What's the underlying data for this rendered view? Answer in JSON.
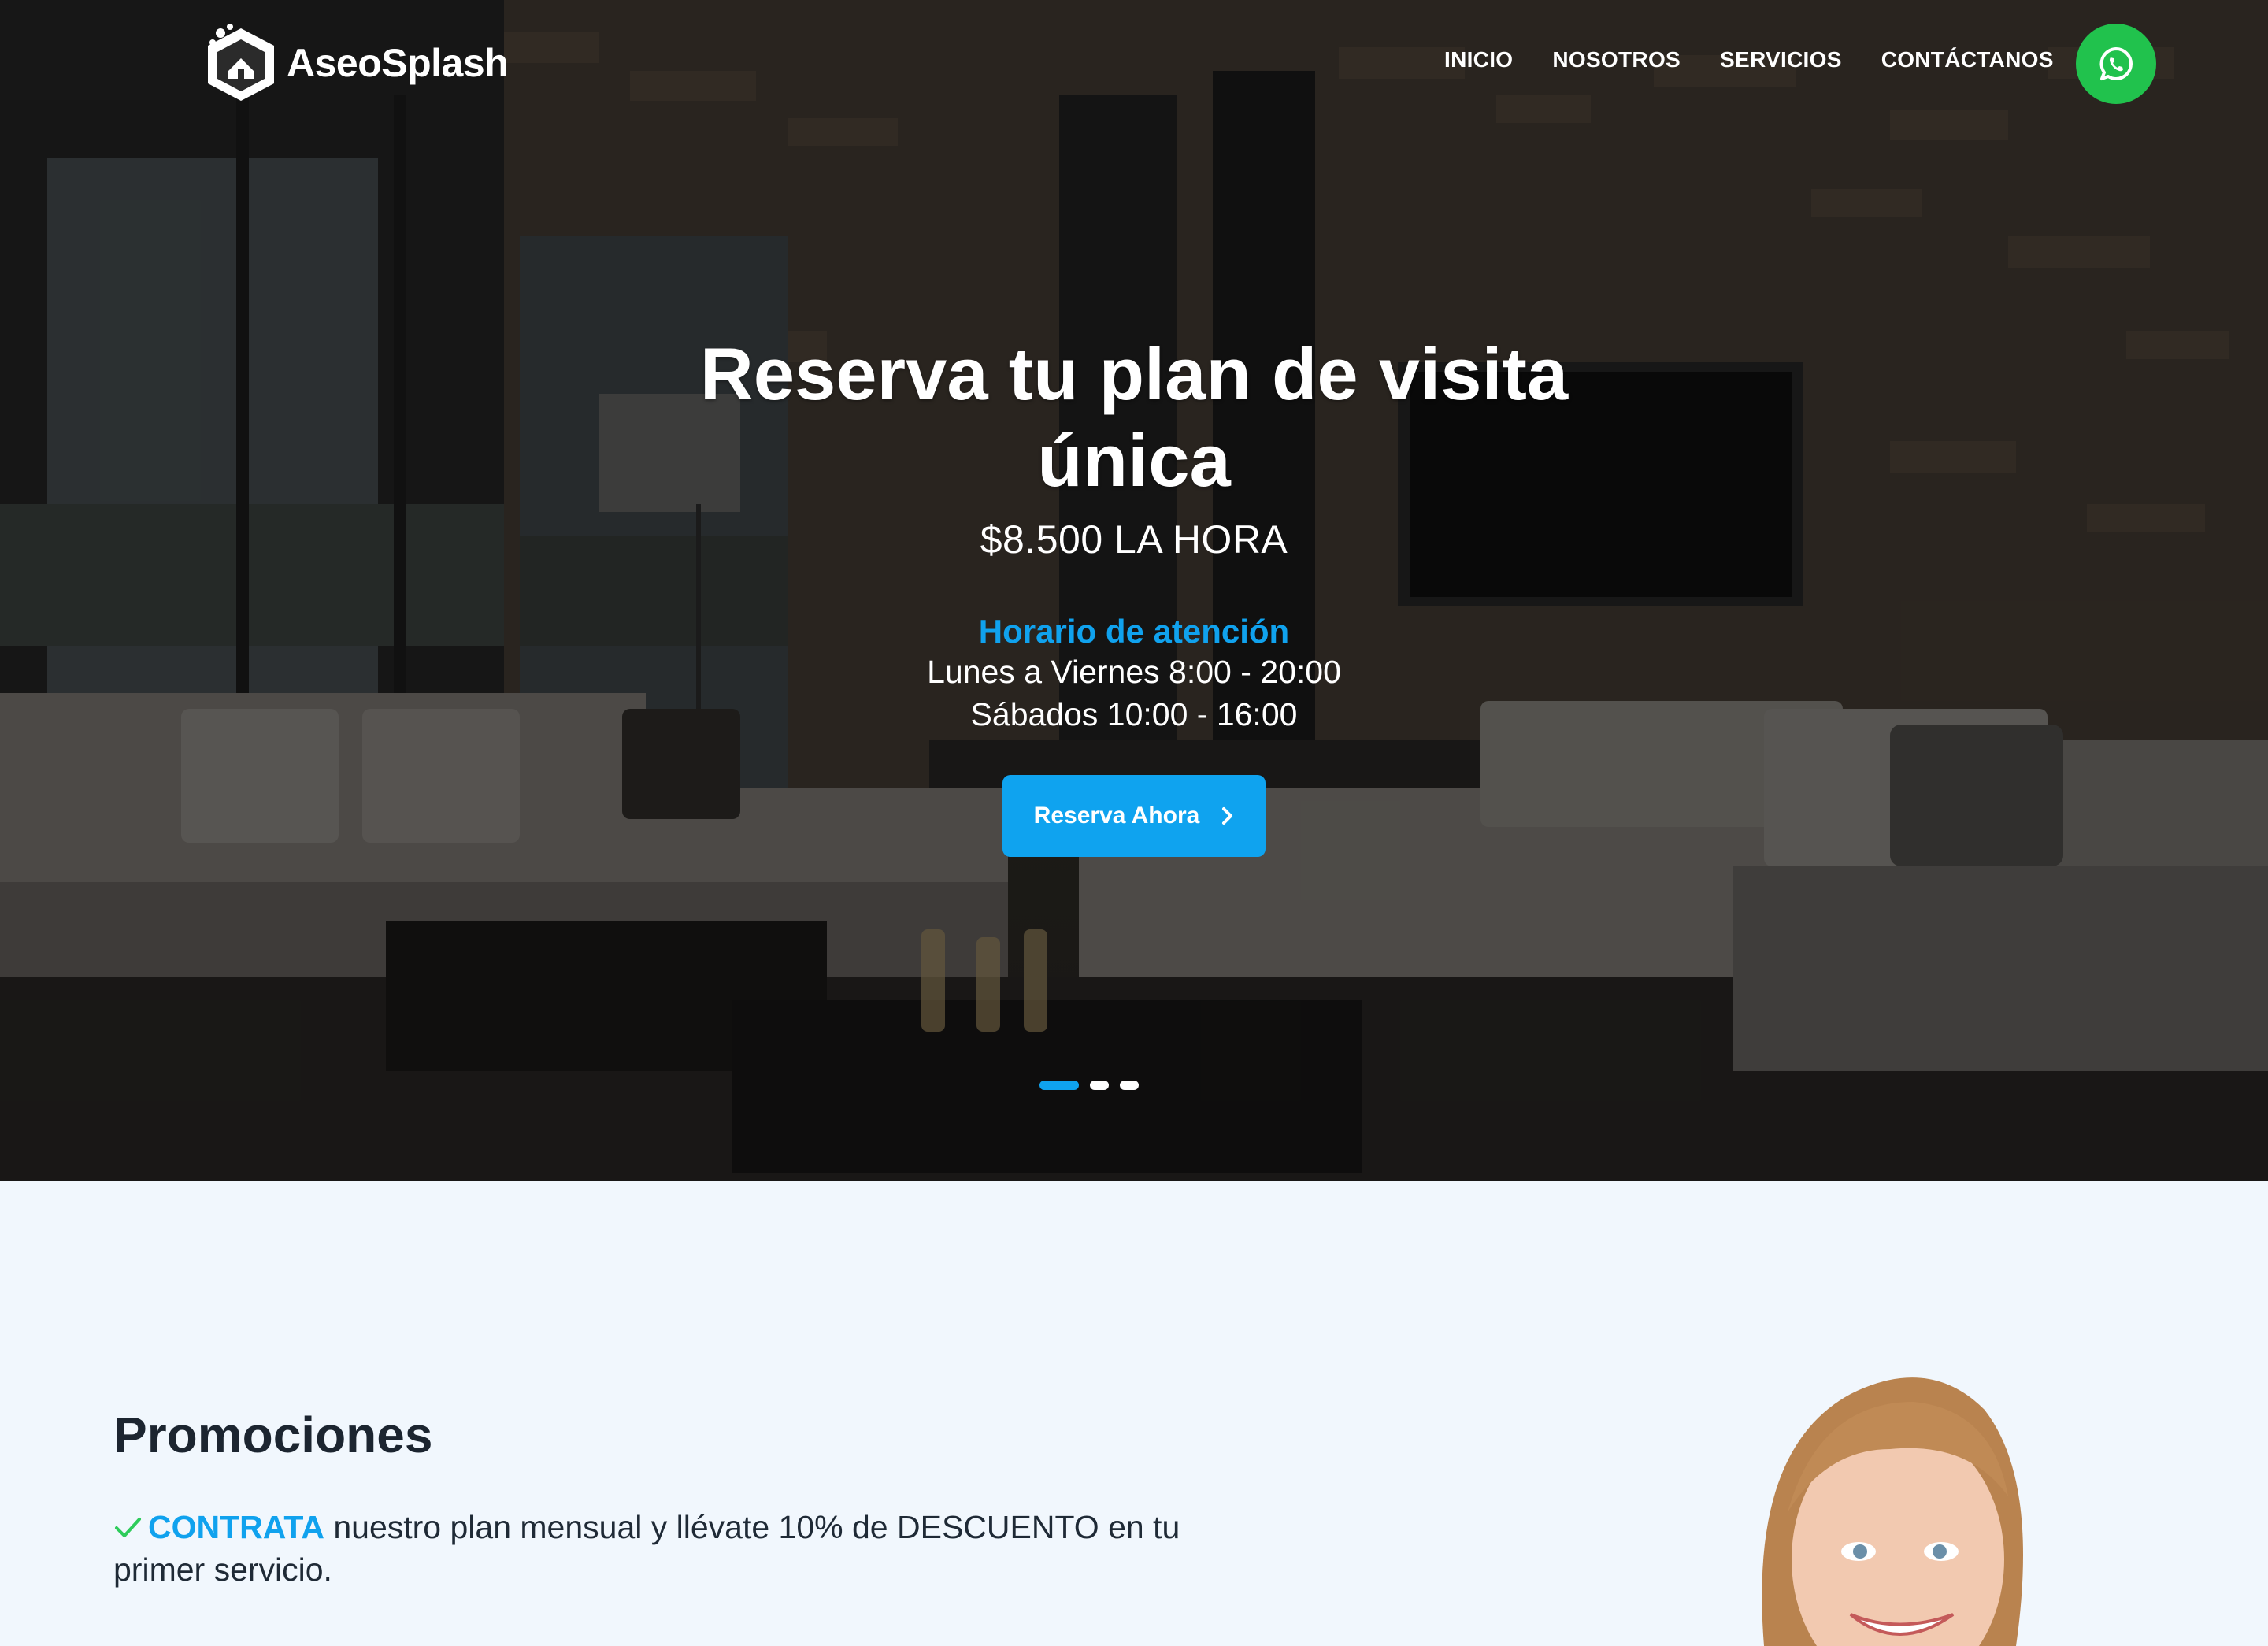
{
  "brand": {
    "name": "AseoSplash"
  },
  "nav": {
    "items": [
      {
        "label": "INICIO"
      },
      {
        "label": "NOSOTROS"
      },
      {
        "label": "SERVICIOS"
      },
      {
        "label": "CONTÁCTANOS"
      }
    ],
    "whatsapp_icon": "whatsapp-icon"
  },
  "hero": {
    "title": "Reserva tu plan de visita única",
    "price": "$8.500 LA HORA",
    "hours_title": "Horario de atención",
    "hours": [
      "Lunes a Viernes 8:00 - 20:00",
      "Sábados 10:00 - 16:00"
    ],
    "cta_label": "Reserva Ahora",
    "slides": {
      "count": 3,
      "active": 1
    }
  },
  "promotions": {
    "title": "Promociones",
    "items": [
      {
        "highlight": "CONTRATA",
        "text": " nuestro plan mensual y llévate 10% de DESCUENTO en tu primer servicio."
      }
    ]
  },
  "colors": {
    "accent": "#0fa3ef",
    "whatsapp": "#21c24d",
    "check": "#2ecc5b",
    "section_bg": "#f1f7fd"
  }
}
